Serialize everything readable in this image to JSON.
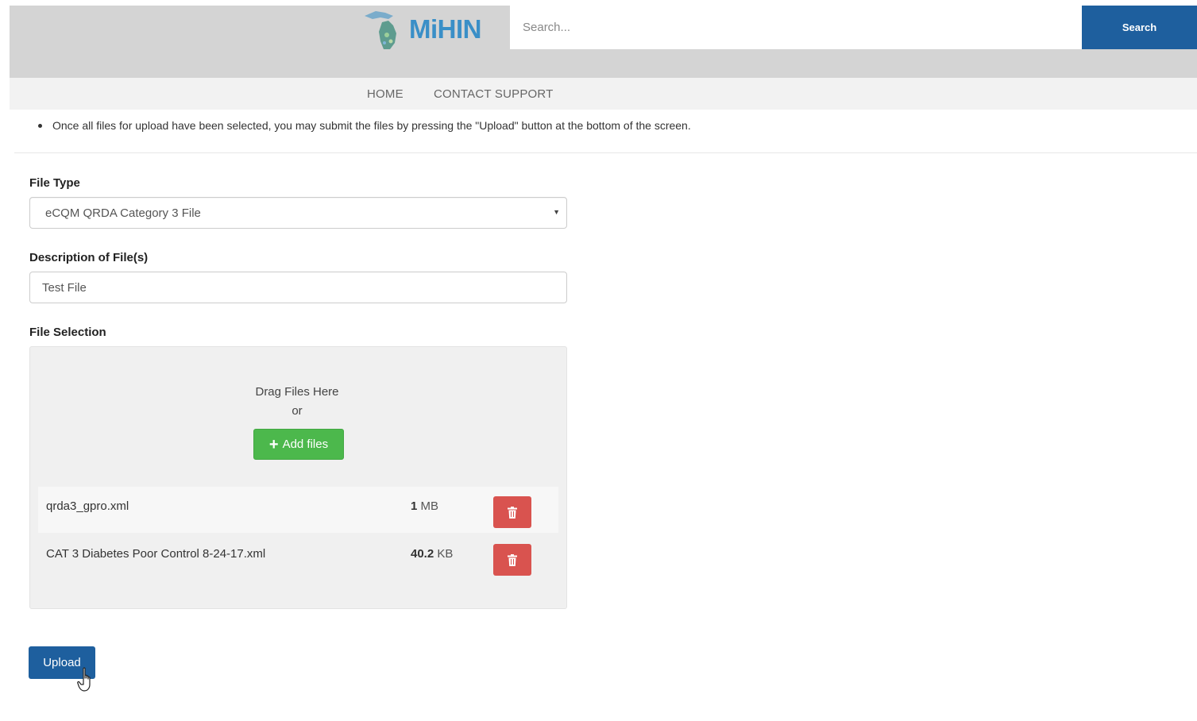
{
  "header": {
    "logo_text": "MiHIN",
    "search": {
      "placeholder": "Search...",
      "button_label": "Search"
    }
  },
  "nav": {
    "items": [
      "HOME",
      "CONTACT SUPPORT"
    ]
  },
  "instructions": {
    "line": "Once all files for upload have been selected, you may submit the files by pressing the \"Upload\" button at the bottom of the screen."
  },
  "form": {
    "file_type": {
      "label": "File Type",
      "selected": "eCQM QRDA Category 3 File"
    },
    "description": {
      "label": "Description of File(s)",
      "value": "Test File"
    },
    "file_selection": {
      "label": "File Selection",
      "drag_text": "Drag Files Here",
      "or_text": "or",
      "add_button_label": "Add files",
      "files": [
        {
          "name": "qrda3_gpro.xml",
          "size_value": "1",
          "size_unit": "MB"
        },
        {
          "name": "CAT 3 Diabetes Poor Control 8-24-17.xml",
          "size_value": "40.2",
          "size_unit": "KB"
        }
      ]
    },
    "upload_button_label": "Upload"
  },
  "colors": {
    "primary": "#1e5f9e",
    "success": "#4cb84c",
    "danger": "#d9534f",
    "brand": "#3a8fc7"
  }
}
